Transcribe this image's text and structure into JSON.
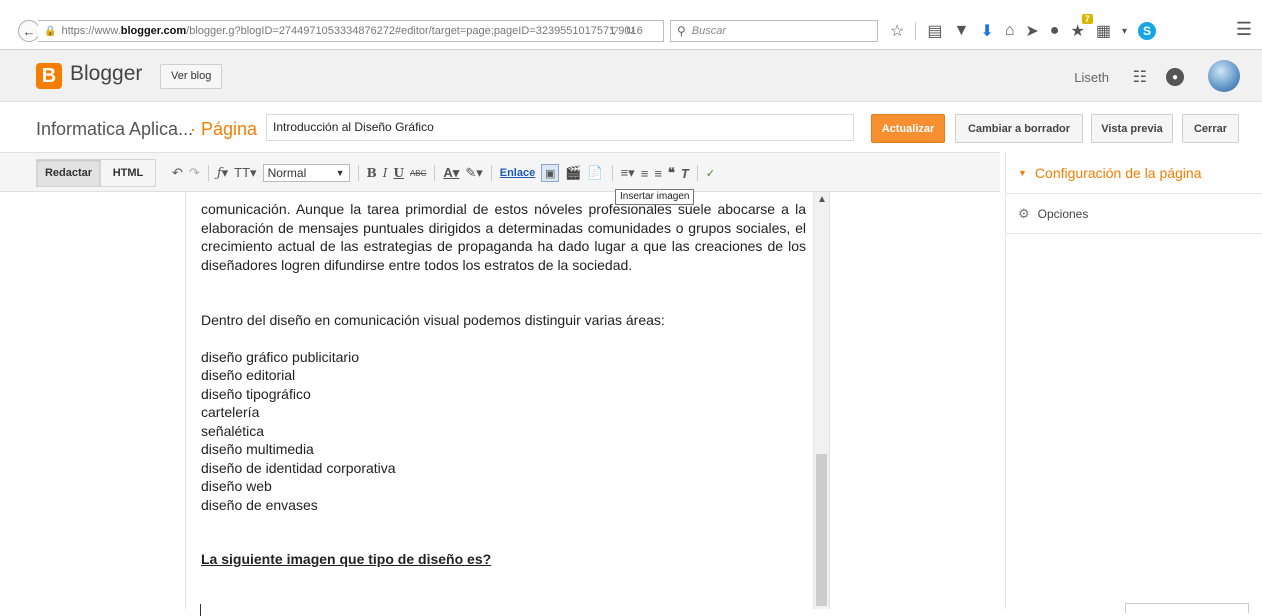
{
  "browser": {
    "url_prefix": "https://www.",
    "url_host": "blogger.com",
    "url_rest": "/blogger.g?blogID=2744971053334876272#editor/target=page;pageID=3239551017571 9016",
    "search_placeholder": "Buscar",
    "addon_badge": "7"
  },
  "header": {
    "brand": "Blogger",
    "view_blog": "Ver blog",
    "user": "Liseth"
  },
  "title_row": {
    "blog_name": "Informatica Aplica...",
    "separator": "·",
    "page_label": "Página",
    "page_title": "Introducción al Diseño Gráfico",
    "update_btn": "Actualizar",
    "draft_btn": "Cambiar a borrador",
    "preview_btn": "Vista previa",
    "close_btn": "Cerrar"
  },
  "toolbar": {
    "compose_tab": "Redactar",
    "html_tab": "HTML",
    "font_style": "Normal",
    "link": "Enlace",
    "tooltip": "Insertar imagen"
  },
  "sidebar": {
    "heading": "Configuración de la página",
    "options": "Opciones"
  },
  "content": {
    "paragraph1": "comunicación. Aunque la tarea primordial de estos nóveles profesionales suele abocarse a la elaboración de mensajes puntuales dirigidos a determinadas comunidades o grupos sociales, el crecimiento actual de las estrategias de propaganda ha dado lugar a que las creaciones de los diseñadores logren difundirse entre todos los estratos de la sociedad.",
    "paragraph2": "Dentro del diseño en comunicación visual podemos distinguir varias áreas:",
    "areas": [
      "diseño gráfico publicitario",
      "diseño editorial",
      "diseño tipográfico",
      "cartelería",
      "señalética",
      "diseño multimedia",
      "diseño de identidad corporativa",
      "diseño web",
      "diseño de envases"
    ],
    "question": "La siguiente imagen que tipo de diseño es?"
  }
}
